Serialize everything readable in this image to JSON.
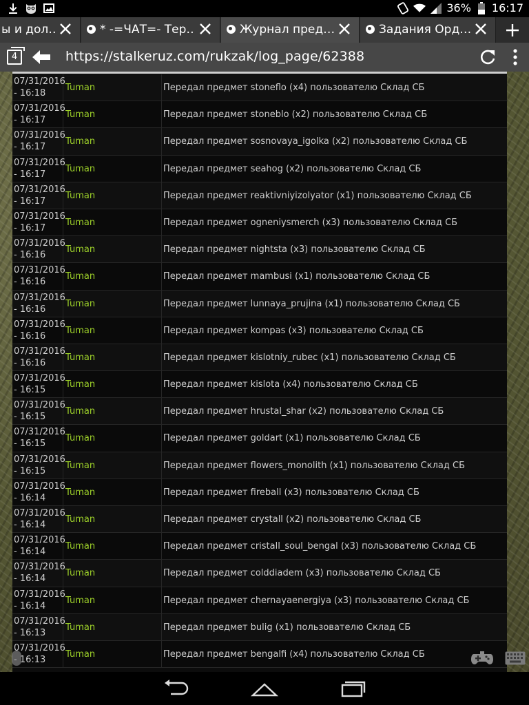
{
  "status_bar": {
    "battery": "36%",
    "time": "16:17",
    "icons": [
      "download-icon",
      "owl-icon",
      "image-icon",
      "rotate-icon",
      "wifi-icon",
      "signal-icon",
      "battery-icon"
    ]
  },
  "tabs": [
    {
      "title": "ы и дол…",
      "active": false
    },
    {
      "title": "* -=ЧАТ=- Тер…",
      "active": false
    },
    {
      "title": "Журнал пред…",
      "active": true
    },
    {
      "title": "Задания Орд…",
      "active": false
    }
  ],
  "address_bar": {
    "tab_count": "4",
    "url": "https://stalkeruz.com/rukzak/log_page/62388"
  },
  "log": {
    "rows": [
      {
        "date": "07/31/2016",
        "time": "- 16:18",
        "user": "Tuman",
        "message": "Передал предмет stoneflo (x4) пользователю Склад СБ"
      },
      {
        "date": "07/31/2016",
        "time": "- 16:17",
        "user": "Tuman",
        "message": "Передал предмет stoneblo (x2) пользователю Склад СБ"
      },
      {
        "date": "07/31/2016",
        "time": "- 16:17",
        "user": "Tuman",
        "message": "Передал предмет sosnovaya_igolka (x2) пользователю Склад СБ"
      },
      {
        "date": "07/31/2016",
        "time": "- 16:17",
        "user": "Tuman",
        "message": "Передал предмет seahog (x2) пользователю Склад СБ"
      },
      {
        "date": "07/31/2016",
        "time": "- 16:17",
        "user": "Tuman",
        "message": "Передал предмет reaktivniyizolyator (x1) пользователю Склад СБ"
      },
      {
        "date": "07/31/2016",
        "time": "- 16:17",
        "user": "Tuman",
        "message": "Передал предмет ogneniysmerch (x3) пользователю Склад СБ"
      },
      {
        "date": "07/31/2016",
        "time": "- 16:16",
        "user": "Tuman",
        "message": "Передал предмет nightsta (x3) пользователю Склад СБ"
      },
      {
        "date": "07/31/2016",
        "time": "- 16:16",
        "user": "Tuman",
        "message": "Передал предмет mambusi (x1) пользователю Склад СБ"
      },
      {
        "date": "07/31/2016",
        "time": "- 16:16",
        "user": "Tuman",
        "message": "Передал предмет lunnaya_prujina (x1) пользователю Склад СБ"
      },
      {
        "date": "07/31/2016",
        "time": "- 16:16",
        "user": "Tuman",
        "message": "Передал предмет kompas (x3) пользователю Склад СБ"
      },
      {
        "date": "07/31/2016",
        "time": "- 16:16",
        "user": "Tuman",
        "message": "Передал предмет kislotniy_rubec (x1) пользователю Склад СБ"
      },
      {
        "date": "07/31/2016",
        "time": "- 16:15",
        "user": "Tuman",
        "message": "Передал предмет kislota (x4) пользователю Склад СБ"
      },
      {
        "date": "07/31/2016",
        "time": "- 16:15",
        "user": "Tuman",
        "message": "Передал предмет hrustal_shar (x2) пользователю Склад СБ"
      },
      {
        "date": "07/31/2016",
        "time": "- 16:15",
        "user": "Tuman",
        "message": "Передал предмет goldart (x1) пользователю Склад СБ"
      },
      {
        "date": "07/31/2016",
        "time": "- 16:15",
        "user": "Tuman",
        "message": "Передал предмет flowers_monolith (x1) пользователю Склад СБ"
      },
      {
        "date": "07/31/2016",
        "time": "- 16:14",
        "user": "Tuman",
        "message": "Передал предмет fireball (x3) пользователю Склад СБ"
      },
      {
        "date": "07/31/2016",
        "time": "- 16:14",
        "user": "Tuman",
        "message": "Передал предмет crystall (x2) пользователю Склад СБ"
      },
      {
        "date": "07/31/2016",
        "time": "- 16:14",
        "user": "Tuman",
        "message": "Передал предмет cristall_soul_bengal (x3) пользователю Склад СБ"
      },
      {
        "date": "07/31/2016",
        "time": "- 16:14",
        "user": "Tuman",
        "message": "Передал предмет colddiadem (x3) пользователю Склад СБ"
      },
      {
        "date": "07/31/2016",
        "time": "- 16:14",
        "user": "Tuman",
        "message": "Передал предмет chernayaenergiya (x3) пользователю Склад СБ"
      },
      {
        "date": "07/31/2016",
        "time": "- 16:13",
        "user": "Tuman",
        "message": "Передал предмет bulig (x1) пользователю Склад СБ"
      },
      {
        "date": "07/31/2016",
        "time": "- 16:13",
        "user": "Tuman",
        "message": "Передал предмет bengalfi (x4) пользователю Склад СБ"
      }
    ]
  },
  "colors": {
    "user_name": "#9fd32a",
    "text": "#cfcfcf",
    "panel": "#0c0c0c",
    "address_bar": "#474747",
    "tab_active": "#4b4b4b"
  },
  "nav_bar": {
    "icons": [
      "back-nav-icon",
      "home-nav-icon",
      "recents-nav-icon"
    ]
  }
}
